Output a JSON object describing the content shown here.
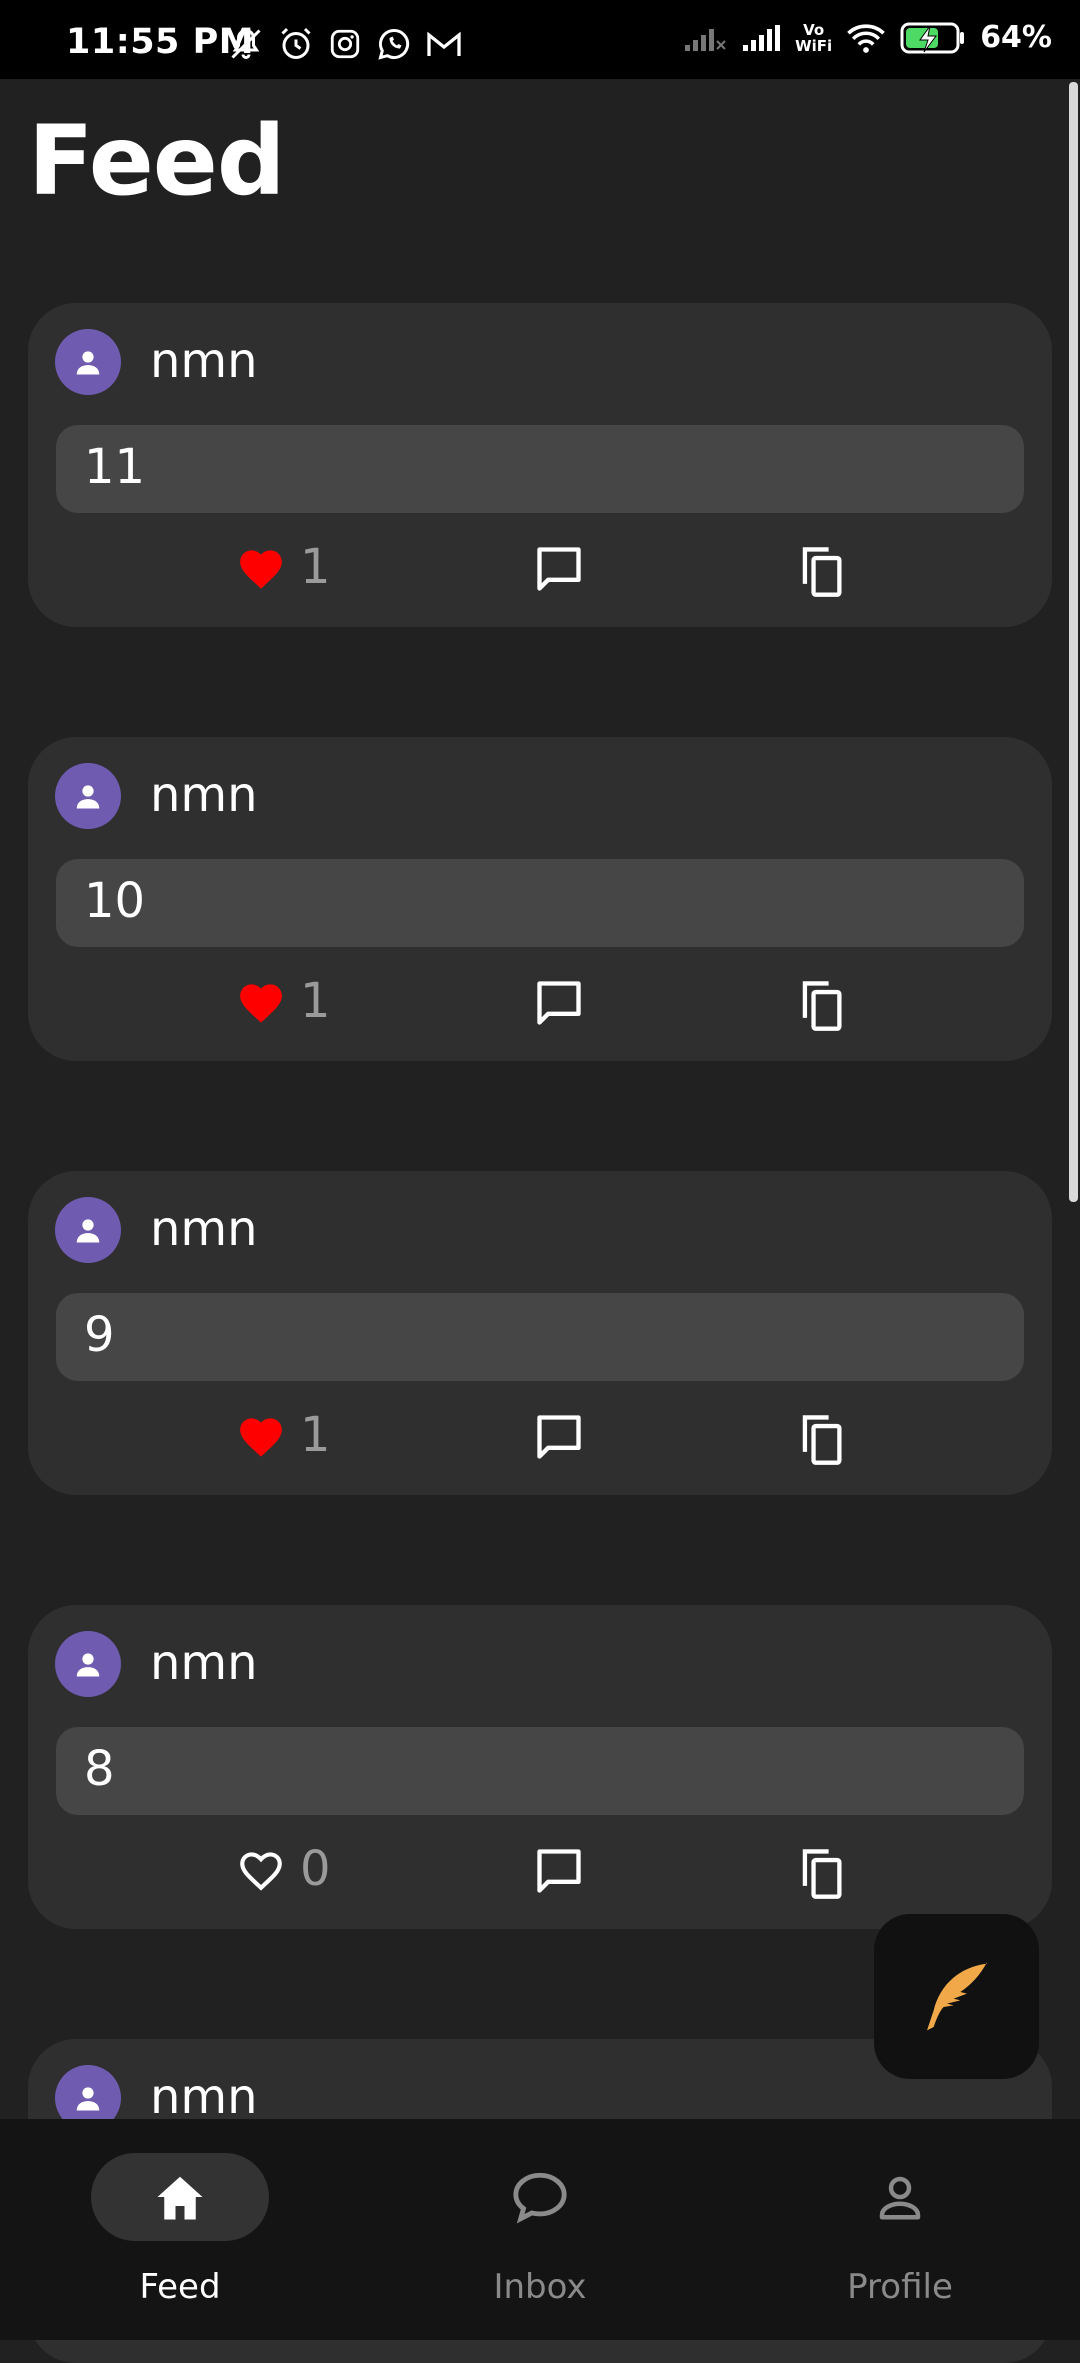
{
  "status_bar": {
    "time": "11:55 PM",
    "left_icons": [
      "mute-icon",
      "alarm-icon",
      "instagram-icon",
      "whatsapp-icon",
      "gmail-icon"
    ],
    "right_icons": [
      "signal-weak-icon",
      "signal-icon",
      "vowifi-icon",
      "wifi-icon",
      "battery-charging-icon"
    ],
    "vowifi_text": "Vo\nWiFi",
    "battery": "64%"
  },
  "page_title": "Feed",
  "colors": {
    "background": "#212121",
    "card": "#2f2f2f",
    "content_box": "#464646",
    "avatar": "#6f5bb0",
    "like_active": "#ff0000",
    "fab_icon": "#f0a848"
  },
  "posts": [
    {
      "username": "nmn",
      "content": "11",
      "likes": "1",
      "liked": true
    },
    {
      "username": "nmn",
      "content": "10",
      "likes": "1",
      "liked": true
    },
    {
      "username": "nmn",
      "content": "9",
      "likes": "1",
      "liked": true
    },
    {
      "username": "nmn",
      "content": "8",
      "likes": "0",
      "liked": false
    },
    {
      "username": "nmn"
    }
  ],
  "fab": {
    "icon": "feather-icon"
  },
  "bottom_nav": [
    {
      "label": "Feed",
      "icon": "home-icon",
      "active": true
    },
    {
      "label": "Inbox",
      "icon": "chat-bubble-icon",
      "active": false
    },
    {
      "label": "Profile",
      "icon": "person-icon",
      "active": false
    }
  ]
}
